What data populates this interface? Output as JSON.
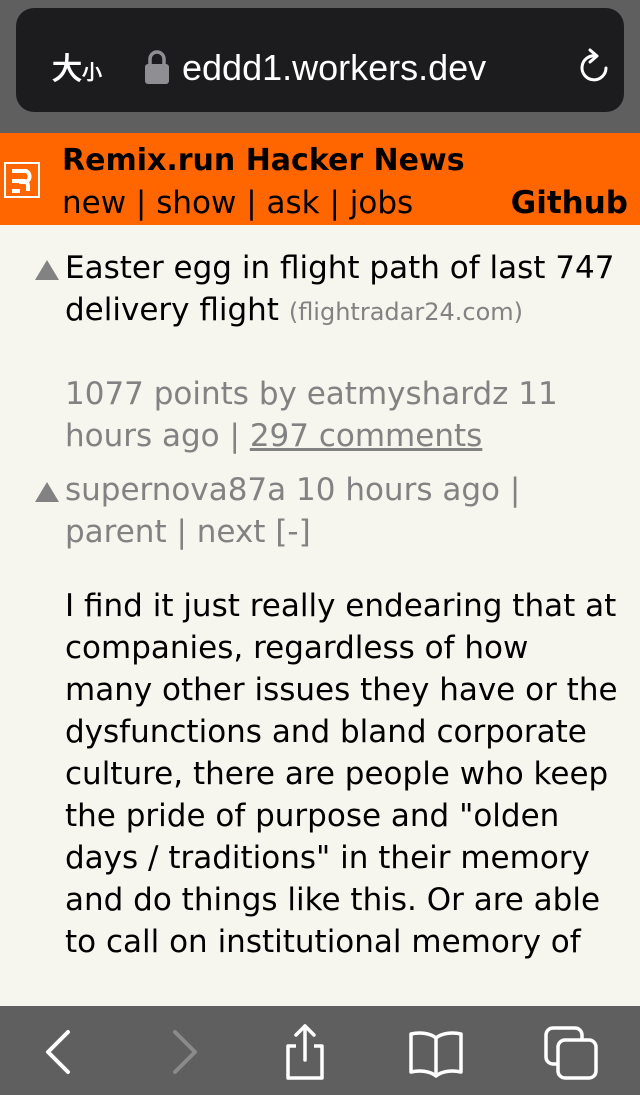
{
  "browser": {
    "text_size_label_big": "大",
    "text_size_label_small": "小",
    "url": "eddd1.workers.dev"
  },
  "header": {
    "title": "Remix.run Hacker News",
    "nav": [
      {
        "label": "new"
      },
      {
        "label": "show"
      },
      {
        "label": "ask"
      },
      {
        "label": "jobs"
      }
    ],
    "separator": " | ",
    "github_label": "Github"
  },
  "story": {
    "title": "Easter egg in flight path of last 747 delivery flight",
    "domain": "(flightradar24.com)",
    "points": "1077 points",
    "by_label": "by",
    "author": "eatmyshardz",
    "age": "11 hours ago",
    "separator": " | ",
    "comments": "297 comments"
  },
  "comment": {
    "author": "supernova87a",
    "age": "10 hours ago",
    "separator": " | ",
    "parent_label": "parent",
    "next_label": "next",
    "toggle_label": "[-]",
    "text": "I find it just really endearing that at companies, regardless of how many other issues they have or the dysfunctions and bland corporate culture, there are people who keep the pride of purpose and \"olden days / traditions\" in their memory and do things like this. Or are able to call on institutional memory of"
  },
  "toolbar": {
    "icons": [
      "back-icon",
      "forward-icon",
      "share-icon",
      "bookmarks-icon",
      "tabs-icon"
    ]
  },
  "colors": {
    "header_orange": "#ff6600",
    "page_bg": "#f6f6ef",
    "meta_gray": "#828282",
    "browser_chrome": "#5f5f5f",
    "url_pill": "#1c1c1e"
  }
}
